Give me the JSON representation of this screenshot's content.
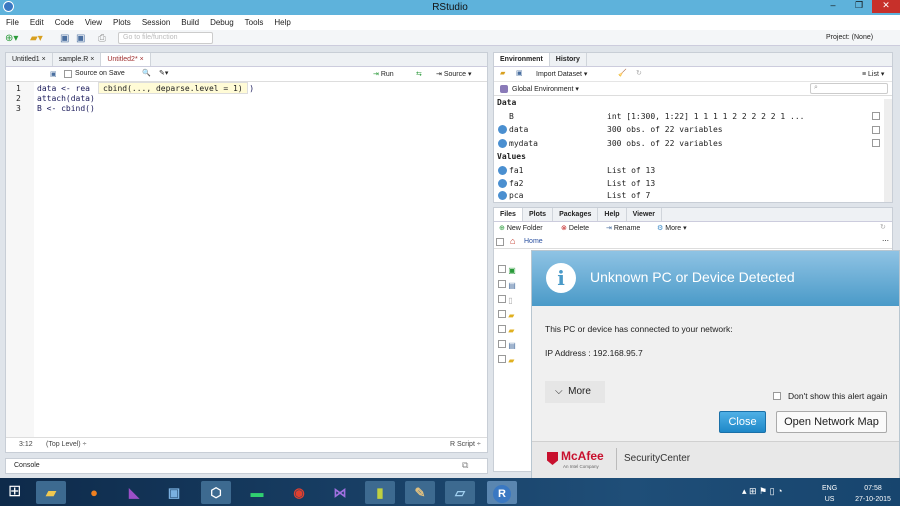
{
  "window": {
    "title": "RStudio",
    "min": "‒",
    "max": "❐",
    "close": "✕"
  },
  "menu": [
    "File",
    "Edit",
    "Code",
    "View",
    "Plots",
    "Session",
    "Build",
    "Debug",
    "Tools",
    "Help"
  ],
  "toolbar": {
    "goto_placeholder": "Go to file/function",
    "project": "Project: (None)"
  },
  "editor": {
    "tabs": [
      "Untitled1",
      "sample.R",
      "Untitled2*"
    ],
    "source_on_save": "Source on Save",
    "run": "Run",
    "source": "Source",
    "lines": [
      {
        "n": "1",
        "code": "data <- rea"
      },
      {
        "n": "2",
        "code": "attach(data)"
      },
      {
        "n": "3",
        "code": "B <- cbind()"
      }
    ],
    "line1_tail": "csv\")",
    "tooltip": "cbind(..., deparse.level = 1)",
    "status": {
      "pos": "3:12",
      "level": "(Top Level) ÷",
      "type": "R Script ÷"
    }
  },
  "console": {
    "label": "Console"
  },
  "environment": {
    "tabs": [
      "Environment",
      "History"
    ],
    "import": "Import Dataset ▾",
    "view": "List ▾",
    "scope": "Global Environment ▾",
    "sections": [
      {
        "title": "Data",
        "rows": [
          {
            "name": "B",
            "value": "int [1:300, 1:22] 1 1 1 1 2 2 2 2 2 1 ..."
          },
          {
            "name": "data",
            "value": "300 obs. of 22 variables"
          },
          {
            "name": "mydata",
            "value": "300 obs. of 22 variables"
          }
        ]
      },
      {
        "title": "Values",
        "rows": [
          {
            "name": "fa1",
            "value": "List of 13"
          },
          {
            "name": "fa2",
            "value": "List of 13"
          },
          {
            "name": "pca",
            "value": "List of 7"
          }
        ]
      }
    ]
  },
  "files": {
    "tabs": [
      "Files",
      "Plots",
      "Packages",
      "Help",
      "Viewer"
    ],
    "new_folder": "New Folder",
    "delete": "Delete",
    "rename": "Rename",
    "more": "More ▾",
    "home": "Home"
  },
  "popup": {
    "title": "Unknown PC or Device Detected",
    "message": "This PC or device has connected to your network:",
    "ip": "IP Address : 192.168.95.7",
    "more": "More",
    "dont_show": "Don't show this alert again",
    "close": "Close",
    "open_map": "Open Network Map",
    "brand": "McAfee",
    "brand_sub": "An Intel Company",
    "product": "SecurityCenter"
  },
  "taskbar": {
    "lang1": "ENG",
    "lang2": "US",
    "time": "07:58",
    "date": "27-10-2015"
  }
}
